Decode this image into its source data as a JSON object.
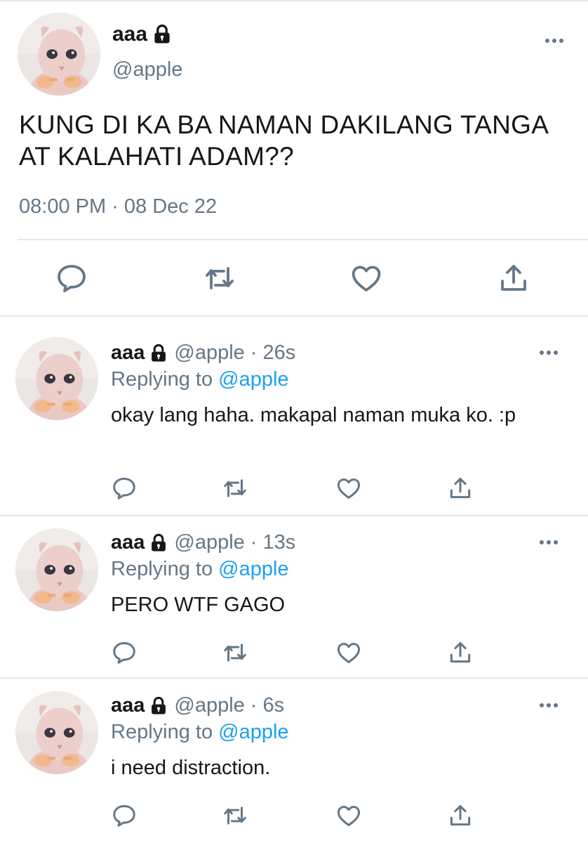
{
  "main_tweet": {
    "name": "aaa",
    "handle": "@apple",
    "text": "KUNG DI KA BA NAMAN DAKILANG TANGA AT KALAHATI ADAM??",
    "timestamp": "08:00 PM · 08 Dec 22"
  },
  "replies": [
    {
      "name": "aaa",
      "handle": "@apple",
      "separator": "·",
      "time_ago": "26s",
      "replying_prefix": "Replying to",
      "replying_to": "@apple",
      "text": "okay lang haha. makapal naman muka ko. :p"
    },
    {
      "name": "aaa",
      "handle": "@apple",
      "separator": "·",
      "time_ago": "13s",
      "replying_prefix": "Replying to",
      "replying_to": "@apple",
      "text": "PERO WTF GAGO"
    },
    {
      "name": "aaa",
      "handle": "@apple",
      "separator": "·",
      "time_ago": "6s",
      "replying_prefix": "Replying to",
      "replying_to": "@apple",
      "text": "i need distraction."
    }
  ],
  "icons": {
    "lock": "lock-icon",
    "more": "more-horizontal-icon",
    "reply": "reply-icon",
    "retweet": "retweet-icon",
    "like": "heart-icon",
    "share": "share-icon"
  },
  "colors": {
    "text": "#14171a",
    "secondary": "#657786",
    "link": "#1da1f2",
    "divider": "#e1e8ed"
  }
}
